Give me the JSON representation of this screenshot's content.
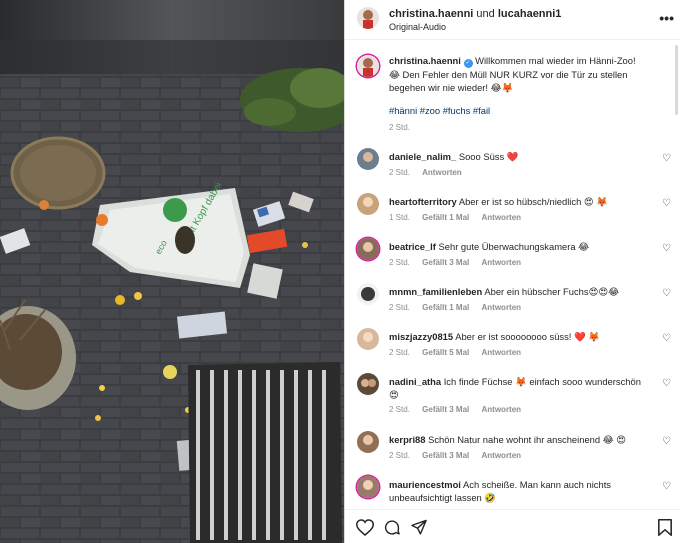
{
  "header": {
    "user1": "christina.haenni",
    "and_word": "und",
    "user2": "lucahaenni1",
    "audio": "Original-Audio",
    "more": "•••"
  },
  "caption": {
    "user": "christina.haenni",
    "verified_mark": "✓",
    "text": "Willkommen mal wieder im Hänni-Zoo! 😂 Den Fehler den Müll NUR KURZ vor die Tür zu stellen begehen wir nie wieder! 😂🦊",
    "tags": "#hänni #zoo #fuchs #fail",
    "time": "2 Std."
  },
  "comments": [
    {
      "user": "daniele_nalim_",
      "text": "Sooo Süss ❤️",
      "time": "2 Std.",
      "likes": "",
      "reply": "Antworten",
      "avatar_color": "#6b7d8f"
    },
    {
      "user": "heartofterritory",
      "text": "Aber er ist so hübsch/niedlich 😍 🦊",
      "time": "1 Std.",
      "likes": "Gefällt 1 Mal",
      "reply": "Antworten",
      "avatar_color": "#c9a27a"
    },
    {
      "user": "beatrice_lf",
      "text": "Sehr gute Überwachungskamera 😂",
      "time": "2 Std.",
      "likes": "Gefällt 3 Mal",
      "reply": "Antworten",
      "avatar_color": "#8a6b5a"
    },
    {
      "user": "mnmn_familienleben",
      "text": "Aber ein hübscher Fuchs😍😍😂",
      "time": "2 Std.",
      "likes": "Gefällt 1 Mal",
      "reply": "Antworten",
      "avatar_color": "#3a3a3a"
    },
    {
      "user": "miszjazzy0815",
      "text": "Aber er ist soooooooo süss! ❤️ 🦊",
      "time": "2 Std.",
      "likes": "Gefällt 5 Mal",
      "reply": "Antworten",
      "avatar_color": "#d8b89a"
    },
    {
      "user": "nadini_atha",
      "text": "Ich finde Füchse 🦊 einfach sooo wunderschön 😍",
      "time": "2 Std.",
      "likes": "Gefällt 3 Mal",
      "reply": "Antworten",
      "avatar_color": "#5a4a3a"
    },
    {
      "user": "kerpri88",
      "text": "Schön Natur nahe wohnt ihr anscheinend 😂 😍",
      "time": "2 Std.",
      "likes": "Gefällt 3 Mal",
      "reply": "Antworten",
      "avatar_color": "#8f6f55"
    },
    {
      "user": "mauriencestmoi",
      "text": "Ach scheiße. Man kann auch nichts unbeaufsichtigt lassen 🤣",
      "time": "",
      "likes": "",
      "reply": "",
      "avatar_color": "#9a7a6a"
    }
  ],
  "icons": {
    "heart": "heart-icon",
    "comment": "comment-icon",
    "share": "share-icon",
    "save": "bookmark-icon",
    "more": "more-icon"
  },
  "colors": {
    "link": "#00376b",
    "meta": "#8e8e8e",
    "verified": "#3897f0",
    "story_ring": "#d6249f"
  }
}
